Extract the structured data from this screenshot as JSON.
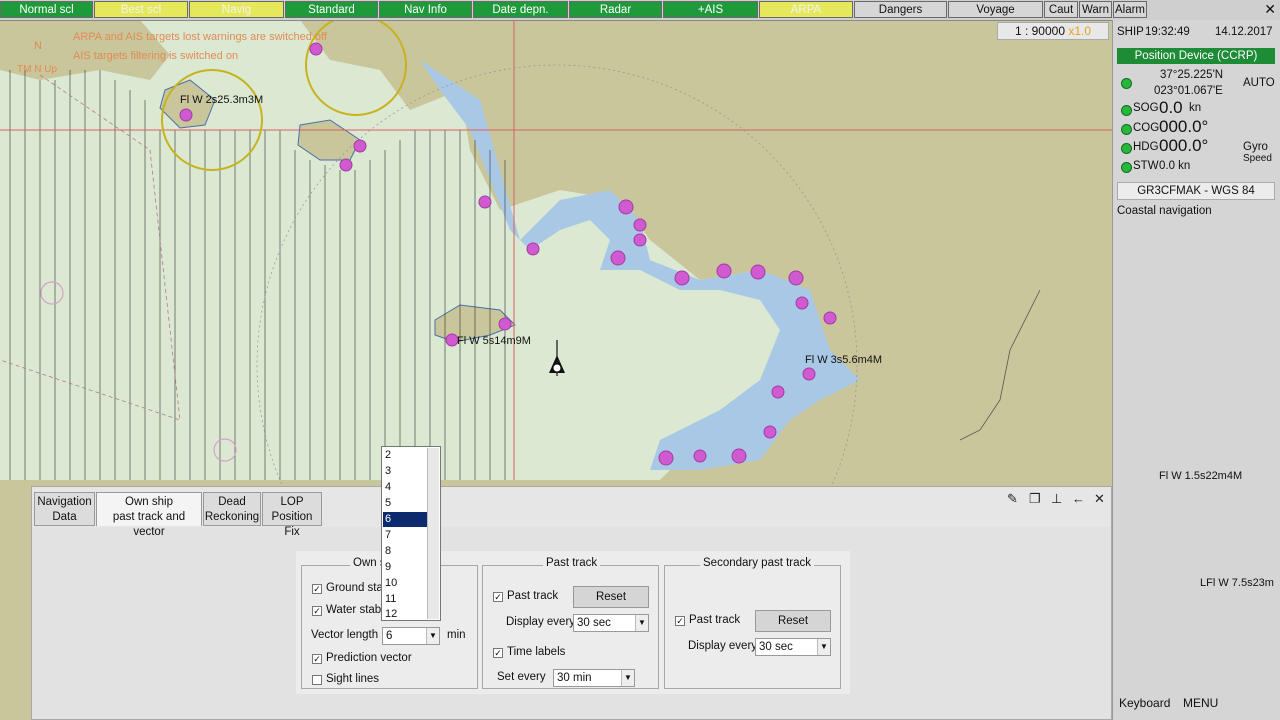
{
  "topbar": {
    "buttons": [
      "Normal scl",
      "Best scl",
      "Navig",
      "Standard",
      "Nav Info",
      "Date depn.",
      "Radar",
      "+AIS",
      "ARPA",
      "Dangers",
      "Voyage",
      "Caut",
      "Warn",
      "Alarm"
    ],
    "close": "✕"
  },
  "chart": {
    "warnings": [
      "ARPA and AIS targets lost warnings are switched off",
      "AIS targets filtering is switched on"
    ],
    "north_label": "N",
    "mode_label": "TM N Up",
    "lights": [
      "Fl W 2s25.3m3M",
      "Fl W 5s14m9M",
      "Fl W 3s5.6m4M",
      "Fl W 1.5s22m4M",
      "LFl W 7.5s23m"
    ],
    "scale": "1 : 90000",
    "scale_mult": "x1.0"
  },
  "right_panel": {
    "ship_label": "SHIP",
    "time": "19:32:49",
    "date": "14.12.2017",
    "position_header": "Position Device (CCRP)",
    "lat": "37°25.225'N",
    "lon": "023°01.067'E",
    "auto": "AUTO",
    "sog_label": "SOG",
    "sog_value": "0.0",
    "sog_unit": "kn",
    "cog_label": "COG",
    "cog_value": "000.0°",
    "hdg_label": "HDG",
    "hdg_value": "000.0°",
    "hdg_src": "Gyro",
    "stw_label": "STW",
    "stw_value": "0.0 kn",
    "speed_label": "Speed",
    "datum": "GR3CFMAK - WGS 84",
    "mode": "Coastal navigation",
    "keyboard": "Keyboard",
    "menu": "MENU"
  },
  "panel": {
    "tabs": [
      {
        "l1": "Navigation",
        "l2": "Data"
      },
      {
        "l1": "Own ship",
        "l2": "past track and vector"
      },
      {
        "l1": "Dead",
        "l2": "Reckoning"
      },
      {
        "l1": "LOP",
        "l2": "Position Fix"
      }
    ],
    "own_ship": {
      "title": "Own s",
      "ground_stab": "Ground stab",
      "water_stab": "Water stabil",
      "vector_length_label": "Vector length",
      "vector_length_value": "6",
      "vector_unit": "min",
      "prediction_vector": "Prediction vector",
      "sight_lines": "Sight lines"
    },
    "past_track": {
      "title": "Past track",
      "checkbox": "Past track",
      "reset": "Reset",
      "display_every_label": "Display every",
      "display_every_value": "30 sec",
      "time_labels": "Time labels",
      "set_every_label": "Set every",
      "set_every_value": "30 min"
    },
    "secondary_track": {
      "title": "Secondary past track",
      "checkbox": "Past track",
      "reset": "Reset",
      "display_every_label": "Display every",
      "display_every_value": "30 sec"
    },
    "dropdown_options": [
      "2",
      "3",
      "4",
      "5",
      "6",
      "7",
      "8",
      "9",
      "10",
      "11",
      "12"
    ],
    "dropdown_selected": "6"
  },
  "colors": {
    "land": "#c8c69a",
    "shallow_water": "#dbe9d2",
    "deep_water": "#a9c8e6",
    "danger_marker": "#d05ad0",
    "green_button": "#1f9a3a",
    "yellow_button": "#e6e85c"
  }
}
